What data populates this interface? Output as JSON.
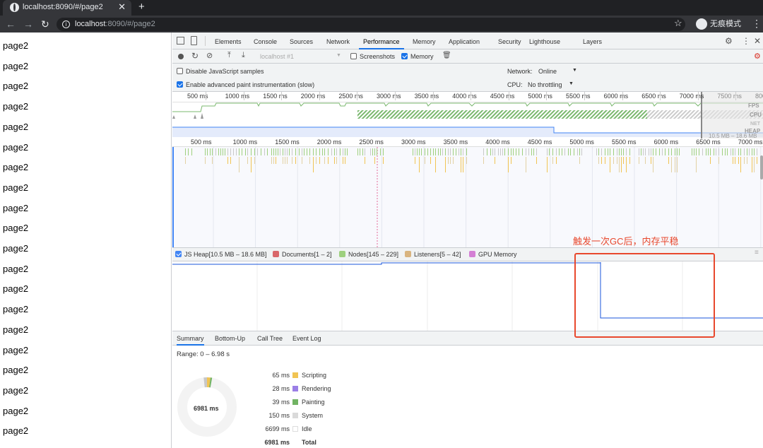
{
  "browser": {
    "tab_title": "localhost:8090/#/page2",
    "url_host": "localhost",
    "url_rest": ":8090/#/page2",
    "incognito_label": "无痕模式"
  },
  "page": {
    "items": [
      "page2",
      "page2",
      "page2",
      "page2",
      "page2",
      "page2",
      "page2",
      "page2",
      "page2",
      "page2",
      "page2",
      "page2",
      "page2",
      "page2",
      "page2",
      "page2",
      "page2",
      "page2",
      "page2",
      "page2"
    ]
  },
  "devtools": {
    "tabs": [
      "Elements",
      "Console",
      "Sources",
      "Network",
      "Performance",
      "Memory",
      "Application",
      "Security",
      "Lighthouse",
      "Layers"
    ],
    "active_tab": "Performance",
    "recording_select": "localhost #1",
    "screenshots_label": "Screenshots",
    "memory_label": "Memory",
    "disable_js_samples": "Disable JavaScript samples",
    "enable_paint": "Enable advanced paint instrumentation (slow)",
    "network_label": "Network:",
    "network_value": "Online",
    "cpu_label": "CPU:",
    "cpu_value": "No throttling",
    "overview_ticks": [
      "500 ms",
      "1000 ms",
      "1500 ms",
      "2000 ms",
      "2500 ms",
      "3000 ms",
      "3500 ms",
      "4000 ms",
      "4500 ms",
      "5000 ms",
      "5500 ms",
      "6000 ms",
      "6500 ms",
      "7000 ms",
      "7500 ms",
      "800"
    ],
    "overview_track_labels": [
      "FPS",
      "CPU",
      "NET",
      "HEAP"
    ],
    "heap_range_overview": "10.5 MB – 18.6 MB",
    "main_ticks": [
      "500 ms",
      "1000 ms",
      "1500 ms",
      "2000 ms",
      "2500 ms",
      "3000 ms",
      "3500 ms",
      "4000 ms",
      "4500 ms",
      "5000 ms",
      "5500 ms",
      "6000 ms",
      "6500 ms",
      "7000 ms"
    ],
    "legend": [
      {
        "label": "JS Heap[10.5 MB – 18.6 MB]",
        "color": "#4285f4",
        "checked": true
      },
      {
        "label": "Documents[1 – 2]",
        "color": "#d9676a",
        "checked": false
      },
      {
        "label": "Nodes[145 – 229]",
        "color": "#9ed07e",
        "checked": false
      },
      {
        "label": "Listeners[5 – 42]",
        "color": "#d9b47f",
        "checked": false
      },
      {
        "label": "GPU Memory",
        "color": "#d47fd4",
        "checked": false
      }
    ],
    "summary_tabs": [
      "Summary",
      "Bottom-Up",
      "Call Tree",
      "Event Log"
    ],
    "range": "Range: 0 – 6.98 s",
    "donut_total": "6981 ms",
    "breakdown": [
      {
        "ms": "65 ms",
        "label": "Scripting",
        "color": "#f1c453",
        "value": 65
      },
      {
        "ms": "28 ms",
        "label": "Rendering",
        "color": "#9b7fe6",
        "value": 28
      },
      {
        "ms": "39 ms",
        "label": "Painting",
        "color": "#71b363",
        "value": 39
      },
      {
        "ms": "150 ms",
        "label": "System",
        "color": "#dadada",
        "value": 150
      },
      {
        "ms": "6699 ms",
        "label": "Idle",
        "color": "#ffffff",
        "value": 6699
      },
      {
        "ms": "6981 ms",
        "label": "Total",
        "color": "",
        "value": 6981
      }
    ]
  },
  "annotation": {
    "text": "触发一次GC后，内存平稳"
  }
}
